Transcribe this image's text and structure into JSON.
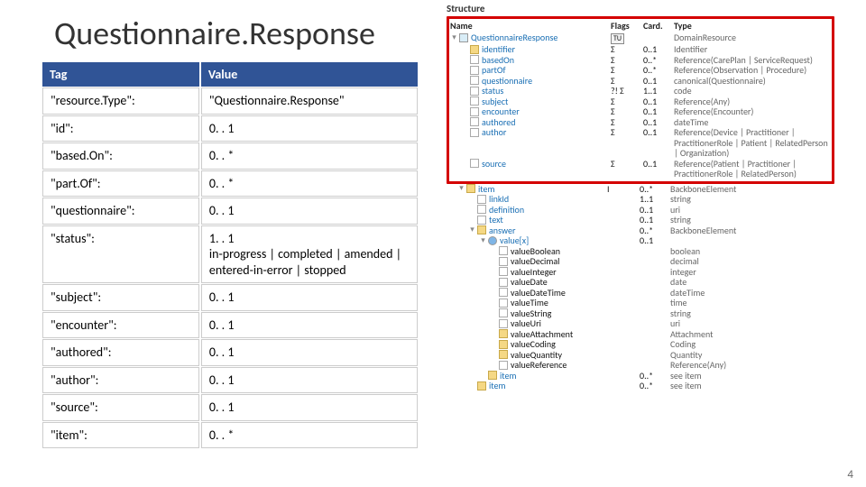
{
  "title": "Questionnaire.Response",
  "table": {
    "headers": {
      "tag": "Tag",
      "value": "Value"
    },
    "rows": [
      {
        "tag": "\"resource.Type\":",
        "value": "\"Questionnaire.Response\""
      },
      {
        "tag": " \"id\":",
        "value": "0. . 1"
      },
      {
        "tag": "\"based.On\":",
        "value": "0. . *"
      },
      {
        "tag": "\"part.Of\":",
        "value": "0. . *"
      },
      {
        "tag": "\"questionnaire\":",
        "value": "0. . 1"
      },
      {
        "tag": "\"status\":",
        "value": "1. . 1\n in-progress | completed | amended | entered-in-error | stopped"
      },
      {
        "tag": "\"subject\":",
        "value": "0. . 1"
      },
      {
        "tag": "\"encounter\":",
        "value": "0. . 1"
      },
      {
        "tag": "\"authored\":",
        "value": "0. . 1"
      },
      {
        "tag": "\"author\":",
        "value": "0. . 1"
      },
      {
        "tag": "\"source\":",
        "value": "0. . 1"
      },
      {
        "tag": "\"item\":",
        "value": "0. . *"
      }
    ]
  },
  "structure": {
    "title": "Structure",
    "headers": {
      "name": "Name",
      "flags": "Flags",
      "card": "Card.",
      "type": "Type"
    },
    "top": [
      {
        "indent": 0,
        "twist": "▾",
        "icon": "res",
        "name": "QuestionnaireResponse",
        "flags": "TU",
        "card": "",
        "type": "DomainResource",
        "link": true
      },
      {
        "indent": 1,
        "twist": "",
        "icon": "folder",
        "name": "identifier",
        "flags": "Σ",
        "card": "0..1",
        "type": "Identifier",
        "link": true
      },
      {
        "indent": 1,
        "twist": "",
        "icon": "leaf",
        "name": "basedOn",
        "flags": "Σ",
        "card": "0..*",
        "type": "Reference(CarePlan | ServiceRequest)",
        "link": true
      },
      {
        "indent": 1,
        "twist": "",
        "icon": "leaf",
        "name": "partOf",
        "flags": "Σ",
        "card": "0..*",
        "type": "Reference(Observation | Procedure)",
        "link": true
      },
      {
        "indent": 1,
        "twist": "",
        "icon": "leaf",
        "name": "questionnaire",
        "flags": "Σ",
        "card": "0..1",
        "type": "canonical(Questionnaire)",
        "link": true
      },
      {
        "indent": 1,
        "twist": "",
        "icon": "leaf",
        "name": "status",
        "flags": "?! Σ",
        "card": "1..1",
        "type": "code",
        "link": true
      },
      {
        "indent": 1,
        "twist": "",
        "icon": "leaf",
        "name": "subject",
        "flags": "Σ",
        "card": "0..1",
        "type": "Reference(Any)",
        "link": true
      },
      {
        "indent": 1,
        "twist": "",
        "icon": "leaf",
        "name": "encounter",
        "flags": "Σ",
        "card": "0..1",
        "type": "Reference(Encounter)",
        "link": true
      },
      {
        "indent": 1,
        "twist": "",
        "icon": "leaf",
        "name": "authored",
        "flags": "Σ",
        "card": "0..1",
        "type": "dateTime",
        "link": true
      },
      {
        "indent": 1,
        "twist": "",
        "icon": "leaf",
        "name": "author",
        "flags": "Σ",
        "card": "0..1",
        "type": "Reference(Device | Practitioner | PractitionerRole | Patient | RelatedPerson | Organization)",
        "link": true
      },
      {
        "indent": 1,
        "twist": "",
        "icon": "leaf",
        "name": "source",
        "flags": "Σ",
        "card": "0..1",
        "type": "Reference(Patient | Practitioner | PractitionerRole | RelatedPerson)",
        "link": true
      }
    ],
    "bottom": [
      {
        "indent": 1,
        "twist": "▾",
        "icon": "folder",
        "name": "item",
        "flags": "I",
        "card": "0..*",
        "type": "BackboneElement",
        "link": true
      },
      {
        "indent": 2,
        "twist": "",
        "icon": "leaf",
        "name": "linkId",
        "flags": "",
        "card": "1..1",
        "type": "string",
        "link": true
      },
      {
        "indent": 2,
        "twist": "",
        "icon": "leaf",
        "name": "definition",
        "flags": "",
        "card": "0..1",
        "type": "uri",
        "link": true
      },
      {
        "indent": 2,
        "twist": "",
        "icon": "leaf",
        "name": "text",
        "flags": "",
        "card": "0..1",
        "type": "string",
        "link": true
      },
      {
        "indent": 2,
        "twist": "▾",
        "icon": "folder",
        "name": "answer",
        "flags": "",
        "card": "0..*",
        "type": "BackboneElement",
        "link": true
      },
      {
        "indent": 3,
        "twist": "▾",
        "icon": "dot",
        "name": "value[x]",
        "flags": "",
        "card": "0..1",
        "type": "",
        "link": true
      },
      {
        "indent": 4,
        "twist": "",
        "icon": "leaf",
        "name": "valueBoolean",
        "flags": "",
        "card": "",
        "type": "boolean",
        "link": false
      },
      {
        "indent": 4,
        "twist": "",
        "icon": "leaf",
        "name": "valueDecimal",
        "flags": "",
        "card": "",
        "type": "decimal",
        "link": false
      },
      {
        "indent": 4,
        "twist": "",
        "icon": "leaf",
        "name": "valueInteger",
        "flags": "",
        "card": "",
        "type": "integer",
        "link": false
      },
      {
        "indent": 4,
        "twist": "",
        "icon": "leaf",
        "name": "valueDate",
        "flags": "",
        "card": "",
        "type": "date",
        "link": false
      },
      {
        "indent": 4,
        "twist": "",
        "icon": "leaf",
        "name": "valueDateTime",
        "flags": "",
        "card": "",
        "type": "dateTime",
        "link": false
      },
      {
        "indent": 4,
        "twist": "",
        "icon": "leaf",
        "name": "valueTime",
        "flags": "",
        "card": "",
        "type": "time",
        "link": false
      },
      {
        "indent": 4,
        "twist": "",
        "icon": "leaf",
        "name": "valueString",
        "flags": "",
        "card": "",
        "type": "string",
        "link": false
      },
      {
        "indent": 4,
        "twist": "",
        "icon": "leaf",
        "name": "valueUri",
        "flags": "",
        "card": "",
        "type": "uri",
        "link": false
      },
      {
        "indent": 4,
        "twist": "",
        "icon": "folder",
        "name": "valueAttachment",
        "flags": "",
        "card": "",
        "type": "Attachment",
        "link": false
      },
      {
        "indent": 4,
        "twist": "",
        "icon": "folder",
        "name": "valueCoding",
        "flags": "",
        "card": "",
        "type": "Coding",
        "link": false
      },
      {
        "indent": 4,
        "twist": "",
        "icon": "folder",
        "name": "valueQuantity",
        "flags": "",
        "card": "",
        "type": "Quantity",
        "link": false
      },
      {
        "indent": 4,
        "twist": "",
        "icon": "leaf",
        "name": "valueReference",
        "flags": "",
        "card": "",
        "type": "Reference(Any)",
        "link": false
      },
      {
        "indent": 3,
        "twist": "",
        "icon": "folder",
        "name": "item",
        "flags": "",
        "card": "0..*",
        "type": "see item",
        "link": true
      },
      {
        "indent": 2,
        "twist": "",
        "icon": "folder",
        "name": "item",
        "flags": "",
        "card": "0..*",
        "type": "see item",
        "link": true
      }
    ]
  },
  "slide_number": "4"
}
